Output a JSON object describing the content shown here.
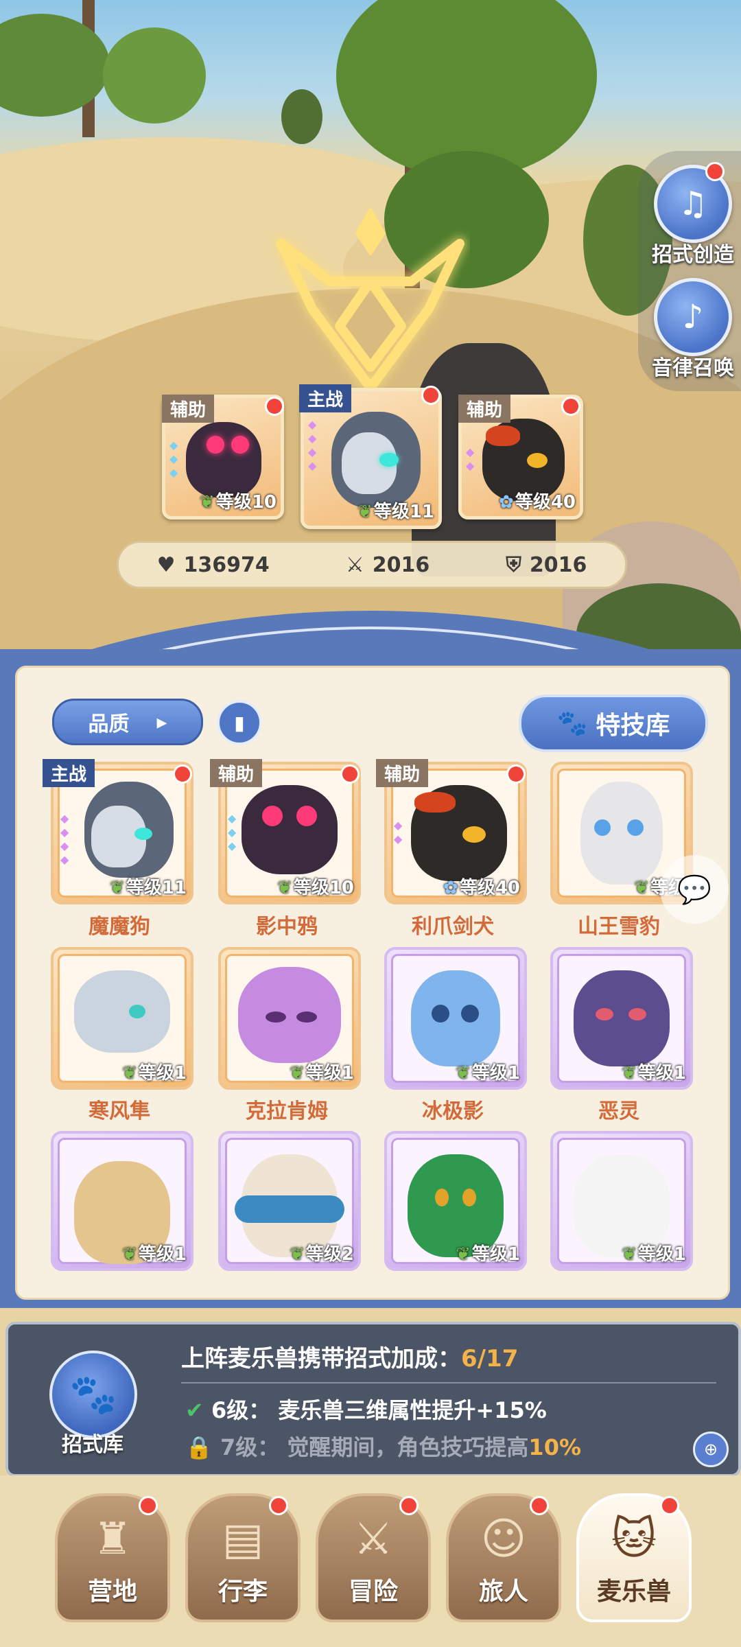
{
  "side_buttons": [
    {
      "label": "招式创造",
      "icon": "music-book-icon"
    },
    {
      "label": "音律召唤",
      "icon": "harp-icon"
    }
  ],
  "team": [
    {
      "tag": "辅助",
      "level": "等级10",
      "color": "#3b2a3e"
    },
    {
      "tag": "主战",
      "level": "等级11",
      "color": "#5b6678"
    },
    {
      "tag": "辅助",
      "level": "等级40",
      "color": "#2e2a28"
    }
  ],
  "stats": {
    "hp": "136974",
    "attack": "2016",
    "defense": "2016"
  },
  "filters": {
    "quality_label": "品质",
    "book_icon": "book-icon",
    "skill_lib_label": "特技库"
  },
  "pets": [
    {
      "name": "魔魔狗",
      "level": "等级11",
      "tag": "主战",
      "rarity": "orange"
    },
    {
      "name": "影中鸦",
      "level": "等级10",
      "tag": "辅助",
      "rarity": "orange"
    },
    {
      "name": "利爪剑犬",
      "level": "等级40",
      "tag": "辅助",
      "rarity": "orange"
    },
    {
      "name": "山王雪豹",
      "level": "等级",
      "tag": "",
      "rarity": "orange"
    },
    {
      "name": "寒风隼",
      "level": "等级1",
      "tag": "",
      "rarity": "orange"
    },
    {
      "name": "克拉肯姆",
      "level": "等级1",
      "tag": "",
      "rarity": "orange"
    },
    {
      "name": "冰极影",
      "level": "等级1",
      "tag": "",
      "rarity": "purple"
    },
    {
      "name": "恶灵",
      "level": "等级1",
      "tag": "",
      "rarity": "purple"
    },
    {
      "name": "",
      "level": "等级1",
      "tag": "",
      "rarity": "purple"
    },
    {
      "name": "",
      "level": "等级2",
      "tag": "",
      "rarity": "purple"
    },
    {
      "name": "",
      "level": "等级1",
      "tag": "",
      "rarity": "purple"
    },
    {
      "name": "",
      "level": "等级1",
      "tag": "",
      "rarity": "purple"
    }
  ],
  "bonus": {
    "icon_label": "招式库",
    "title": "上阵麦乐兽携带招式加成：",
    "progress": "6/17",
    "line1_level": "6级：",
    "line1_text": "麦乐兽三维属性提升+15%",
    "line2_level": "7级：",
    "line2_text_a": "觉醒期间，角色技巧提高",
    "line2_pct": "10%"
  },
  "nav": [
    {
      "label": "营地",
      "icon": "castle-icon"
    },
    {
      "label": "行李",
      "icon": "backpack-icon"
    },
    {
      "label": "冒险",
      "icon": "crossed-swords-icon"
    },
    {
      "label": "旅人",
      "icon": "traveler-icon"
    },
    {
      "label": "麦乐兽",
      "icon": "cat-pet-icon"
    }
  ],
  "colors": {
    "accent_blue": "#4f77c6",
    "name_orange": "#d36a3a",
    "highlight": "#f4b24b",
    "red_dot": "#f0443a"
  }
}
